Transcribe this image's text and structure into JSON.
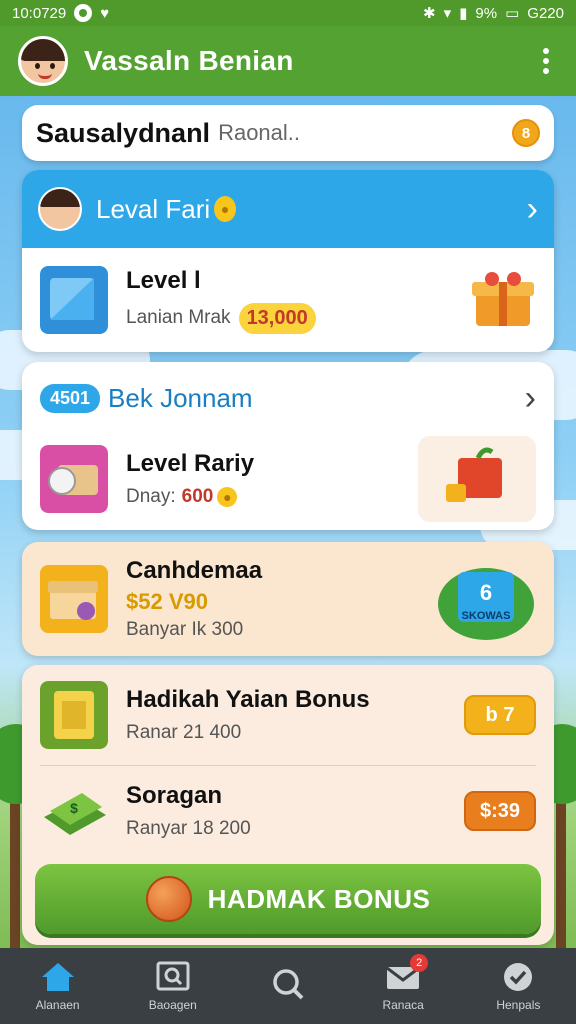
{
  "status_bar": {
    "time": "10:0729",
    "battery": "9%",
    "extra": "G220"
  },
  "header": {
    "title": "Vassaln Benian"
  },
  "search": {
    "value": "Sausalydnanl",
    "placeholder": "Raonal..",
    "coin_label": "8"
  },
  "level_card": {
    "title": "Leval Fari",
    "item_title": "Level l",
    "item_subtitle": "Lanian Mrak",
    "item_value": "13,000"
  },
  "bonus_card": {
    "badge": "4501",
    "title": "Bek Jonnam",
    "item_title": "Level Rariy",
    "item_subtitle": "Dnay:",
    "item_value": "600"
  },
  "offer_card": {
    "title": "Canhdemaa",
    "price": "$52 V90",
    "subtitle": "Banyar Ik 300",
    "promo_label": "SKOWAS"
  },
  "list_card": {
    "items": [
      {
        "title": "Hadikah Yaian Bonus",
        "subtitle": "Ranar 21 400",
        "button": "b 7"
      },
      {
        "title": "Soragan",
        "subtitle": "Ranyar 18 200",
        "button": "$:39"
      }
    ]
  },
  "cta": {
    "label": "HADMAK BONUS"
  },
  "bottom_nav": [
    {
      "label": "Alanaen",
      "icon": "home-icon",
      "active": true
    },
    {
      "label": "Baoagen",
      "icon": "frame-search-icon"
    },
    {
      "label": "",
      "icon": "search-icon"
    },
    {
      "label": "Ranaca",
      "icon": "mail-icon",
      "badge": "2"
    },
    {
      "label": "Henpals",
      "icon": "check-badge-icon"
    }
  ],
  "colors": {
    "header": "#53a232",
    "accent_blue": "#2ea7e8",
    "cta": "#4f9a2b"
  }
}
